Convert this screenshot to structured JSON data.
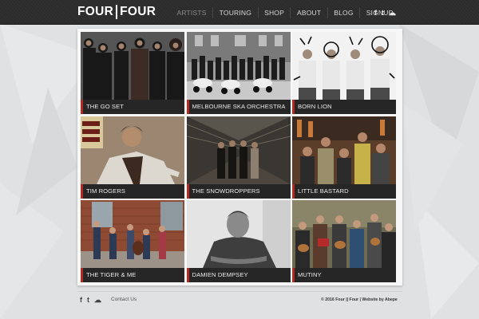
{
  "header": {
    "logo_left": "FOUR",
    "logo_right": "FOUR",
    "nav": [
      {
        "label": "ARTISTS",
        "active": true
      },
      {
        "label": "TOURING",
        "active": false
      },
      {
        "label": "SHOP",
        "active": false
      },
      {
        "label": "ABOUT",
        "active": false
      },
      {
        "label": "BLOG",
        "active": false
      },
      {
        "label": "SIGNUP",
        "active": false
      }
    ],
    "social": [
      {
        "icon": "facebook-icon",
        "glyph": "f"
      },
      {
        "icon": "twitter-icon",
        "glyph": "t"
      },
      {
        "icon": "soundcloud-icon",
        "glyph": "☁"
      }
    ]
  },
  "artists": [
    {
      "name": "THE GO SET",
      "photo": "group-dark"
    },
    {
      "name": "MELBOURNE SKA ORCHESTRA",
      "photo": "street-scooters"
    },
    {
      "name": "BORN LION",
      "photo": "bw-four-doodle"
    },
    {
      "name": "TIM ROGERS",
      "photo": "single-suit"
    },
    {
      "name": "THE SNOWDROPPERS",
      "photo": "barn-group"
    },
    {
      "name": "LITTLE BASTARD",
      "photo": "bar-colour-group"
    },
    {
      "name": "THE TIGER & ME",
      "photo": "brick-wall-band"
    },
    {
      "name": "DAMIEN DEMPSEY",
      "photo": "bw-portrait"
    },
    {
      "name": "MUTINY",
      "photo": "colour-band-instruments"
    }
  ],
  "footer": {
    "contact_label": "Contact Us",
    "copyright": "© 2016 Four || Four | Website by Abepe",
    "social": [
      {
        "icon": "facebook-icon",
        "glyph": "f"
      },
      {
        "icon": "twitter-icon",
        "glyph": "t"
      },
      {
        "icon": "soundcloud-icon",
        "glyph": "☁"
      }
    ]
  },
  "colors": {
    "header_bg": "#2c2c2c",
    "accent": "#b32a21",
    "page_bg": "#dfe1e3",
    "caption_bg": "#262626"
  }
}
